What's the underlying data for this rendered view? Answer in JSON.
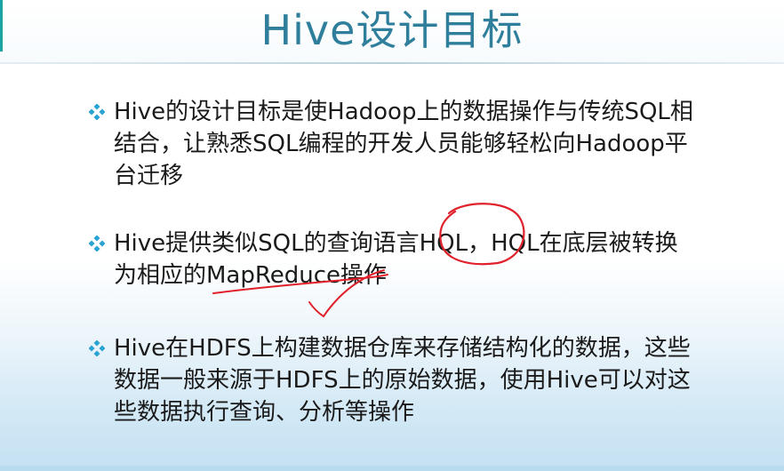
{
  "slide": {
    "title": "Hive设计目标",
    "bullets": [
      {
        "text": "Hive的设计目标是使Hadoop上的数据操作与传统SQL相\n结合，让熟悉SQL编程的开发人员能够轻松向Hadoop平\n台迁移"
      },
      {
        "text": "Hive提供类似SQL的查询语言HQL，HQL在底层被转换\n为相应的MapReduce操作"
      },
      {
        "text": "Hive在HDFS上构建数据仓库来存储结构化的数据，这些\n数据一般来源于HDFS上的原始数据，使用Hive可以对这\n些数据执行查询、分析等操作"
      }
    ],
    "annotations": {
      "ink_color": "#e0202a",
      "marks": [
        "circle-around-hql",
        "underline-mapreduce",
        "checkmark"
      ]
    }
  },
  "colors": {
    "title": "#2f7f9c",
    "bullet_icon": "#2aa3d3",
    "body_text": "#1a1a1a",
    "accent": "#1aa3a3"
  }
}
